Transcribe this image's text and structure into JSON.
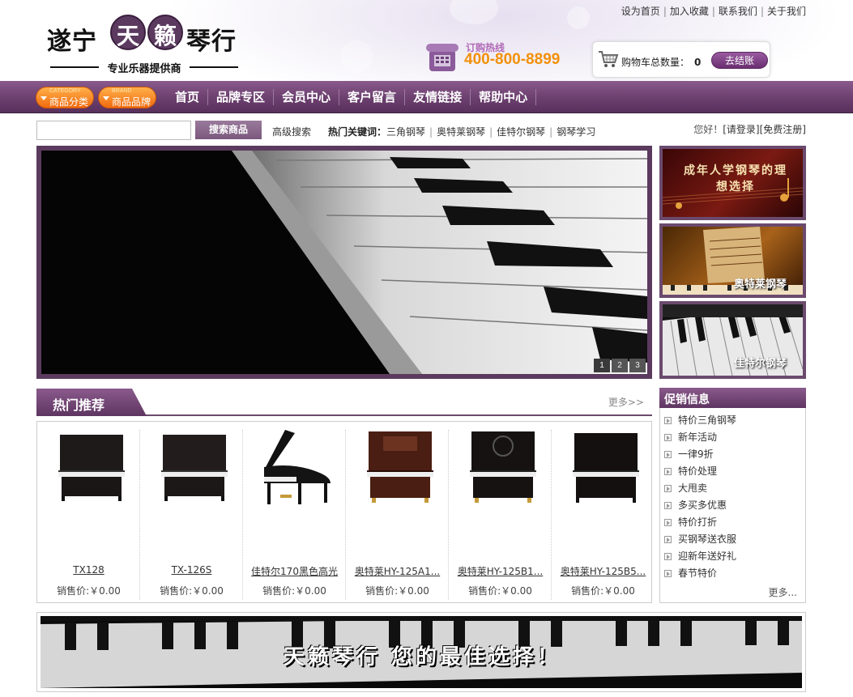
{
  "top_links": [
    "设为首页",
    "加入收藏",
    "联系我们",
    "关于我们"
  ],
  "logo": {
    "brand_left": "遂宁",
    "brand_char1": "天",
    "brand_char2": "籁",
    "brand_right": "琴行",
    "tagline": "专业乐器提供商"
  },
  "hotline": {
    "label": "订购热线",
    "number": "400-800-8899"
  },
  "cart": {
    "label": "购物车总数量：",
    "count": "0",
    "checkout": "去结账"
  },
  "nav": {
    "category_small": "CATEGORY",
    "category": "商品分类",
    "brand_small": "BRAND",
    "brand": "商品品牌",
    "links": [
      "首页",
      "品牌专区",
      "会员中心",
      "客户留言",
      "友情链接",
      "帮助中心"
    ]
  },
  "search": {
    "placeholder": "",
    "button": "搜索商品",
    "advanced": "高级搜索",
    "hot_label": "热门关键词：",
    "hot_keywords": [
      "三角钢琴",
      "奥特莱钢琴",
      "佳特尔钢琴",
      "钢琴学习"
    ]
  },
  "login": {
    "greeting": "您好！",
    "login": "[请登录]",
    "register": "[免费注册]"
  },
  "banner": {
    "slides": [
      "1",
      "2",
      "3"
    ],
    "active": 0
  },
  "side_ads": [
    {
      "text": "成年人学钢琴的理想选择"
    },
    {
      "text": "奥特莱钢琴"
    },
    {
      "text": "佳特尔钢琴"
    }
  ],
  "hot_section": {
    "title": "热门推荐",
    "more": "更多>>"
  },
  "products": [
    {
      "name": "TX128",
      "price": "销售价:￥0.00",
      "kind": "upright"
    },
    {
      "name": "TX-126S",
      "price": "销售价:￥0.00",
      "kind": "upright"
    },
    {
      "name": "佳特尔170黑色高光",
      "price": "销售价:￥0.00",
      "kind": "grand"
    },
    {
      "name": "奥特莱HY-125A1...",
      "price": "销售价:￥0.00",
      "kind": "upright-brown"
    },
    {
      "name": "奥特莱HY-125B1...",
      "price": "销售价:￥0.00",
      "kind": "upright-ornate"
    },
    {
      "name": "奥特莱HY-125B5...",
      "price": "销售价:￥0.00",
      "kind": "upright"
    }
  ],
  "promo": {
    "title": "促销信息",
    "items": [
      "特价三角钢琴",
      "新年活动",
      "一律9折",
      "特价处理",
      "大甩卖",
      "多买多优惠",
      "特价打折",
      "买钢琴送衣服",
      "迎新年送好礼",
      "春节特价"
    ],
    "more": "更多..."
  },
  "bottom_banner": {
    "slogan": "天籁琴行 您的最佳选择！"
  },
  "colors": {
    "purple": "#6b3f6e",
    "orange": "#f2900a",
    "pill": "#f06a0f"
  }
}
